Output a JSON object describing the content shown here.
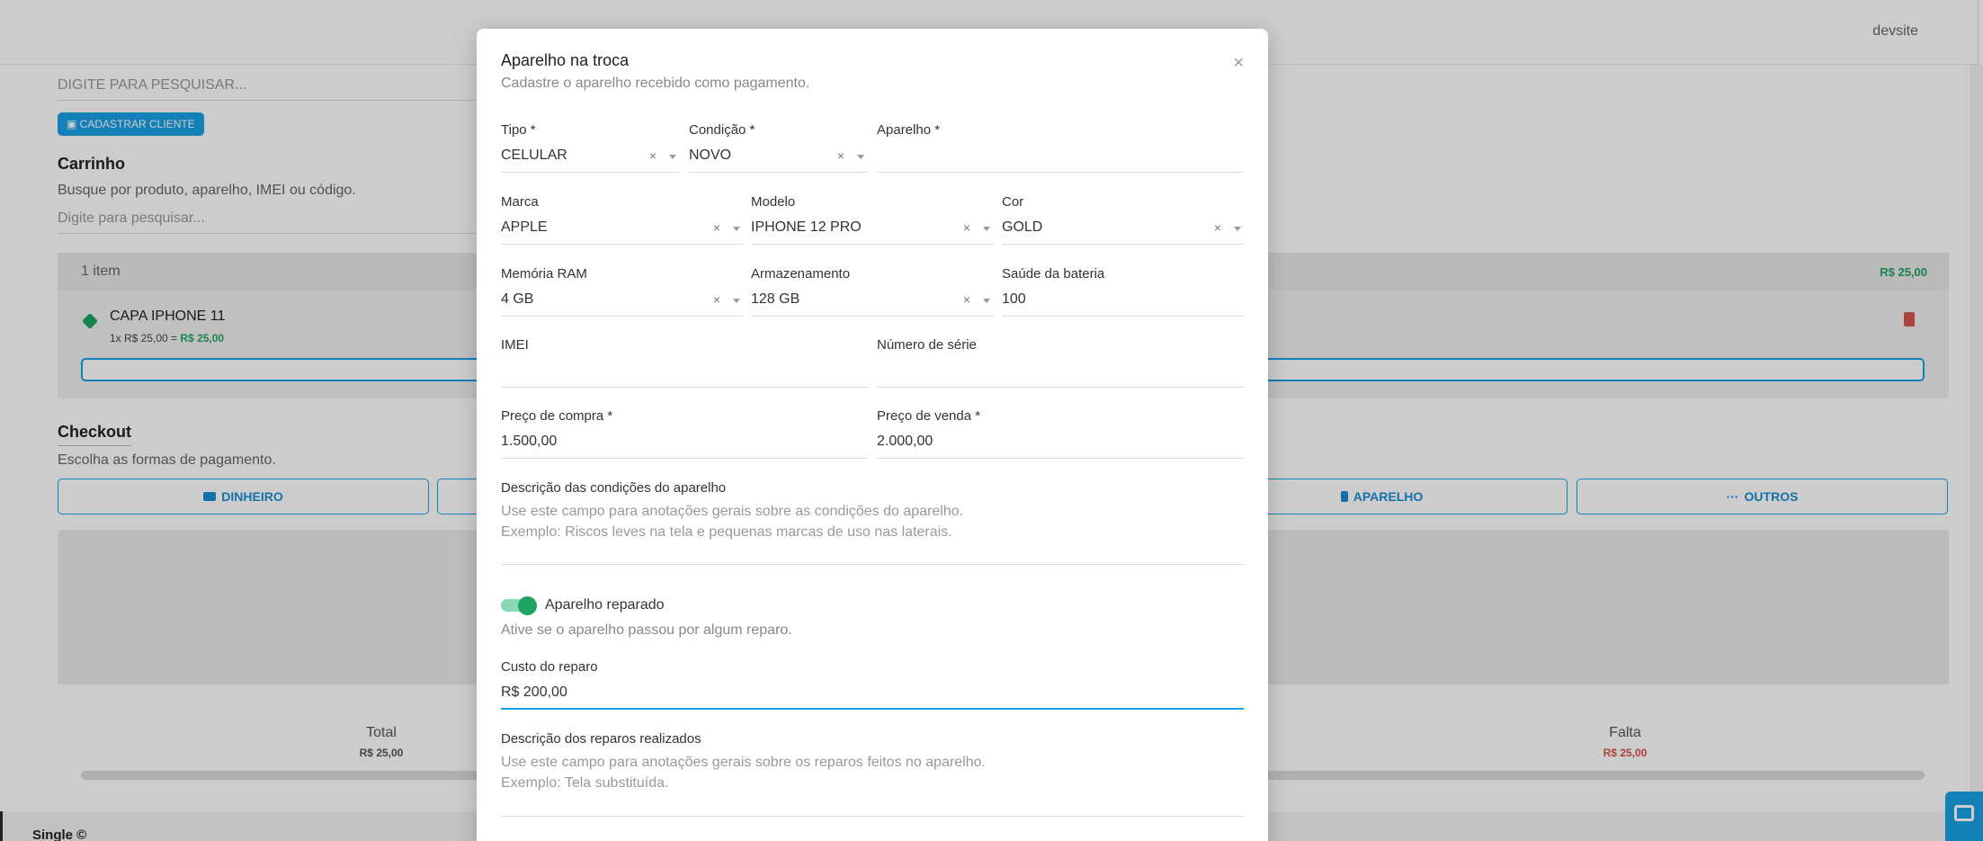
{
  "topbar": {
    "user": "devsite"
  },
  "background": {
    "search_placeholder": "DIGITE PARA PESQUISAR...",
    "register_client_button": "CADASTRAR CLIENTE",
    "cart": {
      "title": "Carrinho",
      "subtitle": "Busque por produto, aparelho, IMEI ou código.",
      "search_placeholder": "Digite para pesquisar...",
      "count": "1 item",
      "total": "R$ 25,00",
      "item": {
        "name": "CAPA IPHONE 11",
        "price_prefix": "1x R$ 25,00 = ",
        "price_total": "R$ 25,00"
      }
    },
    "checkout": {
      "title": "Checkout",
      "subtitle": "Escolha as formas de pagamento.",
      "methods": [
        "DINHEIRO",
        "APARELHO",
        "OUTROS"
      ]
    },
    "summary": {
      "total_label": "Total",
      "total_value": "R$ 25,00",
      "falta_label": "Falta",
      "falta_value": "R$ 25,00"
    },
    "footer_brand": "Single ©"
  },
  "modal": {
    "title": "Aparelho na troca",
    "subtitle": "Cadastre o aparelho recebido como pagamento.",
    "close": "×",
    "fields": {
      "tipo": {
        "label": "Tipo *",
        "value": "CELULAR"
      },
      "condicao": {
        "label": "Condição *",
        "value": "NOVO"
      },
      "aparelho": {
        "label": "Aparelho *",
        "value": ""
      },
      "marca": {
        "label": "Marca",
        "value": "APPLE"
      },
      "modelo": {
        "label": "Modelo",
        "value": "IPHONE 12 PRO"
      },
      "cor": {
        "label": "Cor",
        "value": "GOLD"
      },
      "memoria": {
        "label": "Memória RAM",
        "value": "4 GB"
      },
      "armazenamento": {
        "label": "Armazenamento",
        "value": "128 GB"
      },
      "bateria": {
        "label": "Saúde da bateria",
        "value": "100"
      },
      "imei": {
        "label": "IMEI",
        "value": ""
      },
      "serie": {
        "label": "Número de série",
        "value": ""
      },
      "preco_compra": {
        "label": "Preço de compra *",
        "value": "1.500,00"
      },
      "preco_venda": {
        "label": "Preço de venda *",
        "value": "2.000,00"
      },
      "custo_reparo": {
        "label": "Custo do reparo",
        "value": "R$ 200,00"
      }
    },
    "descricao_condicoes": {
      "label": "Descrição das condições do aparelho",
      "placeholder_line1": "Use este campo para anotações gerais sobre as condições do aparelho.",
      "placeholder_line2": "Exemplo: Riscos leves na tela e pequenas marcas de uso nas laterais."
    },
    "reparado": {
      "label": "Aparelho reparado",
      "help": "Ative se o aparelho passou por algum reparo.",
      "checked": true
    },
    "descricao_reparos": {
      "label": "Descrição dos reparos realizados",
      "placeholder_line1": "Use este campo para anotações gerais sobre os reparos feitos no aparelho.",
      "placeholder_line2": "Exemplo: Tela substituída."
    },
    "clear_icon": "×"
  }
}
